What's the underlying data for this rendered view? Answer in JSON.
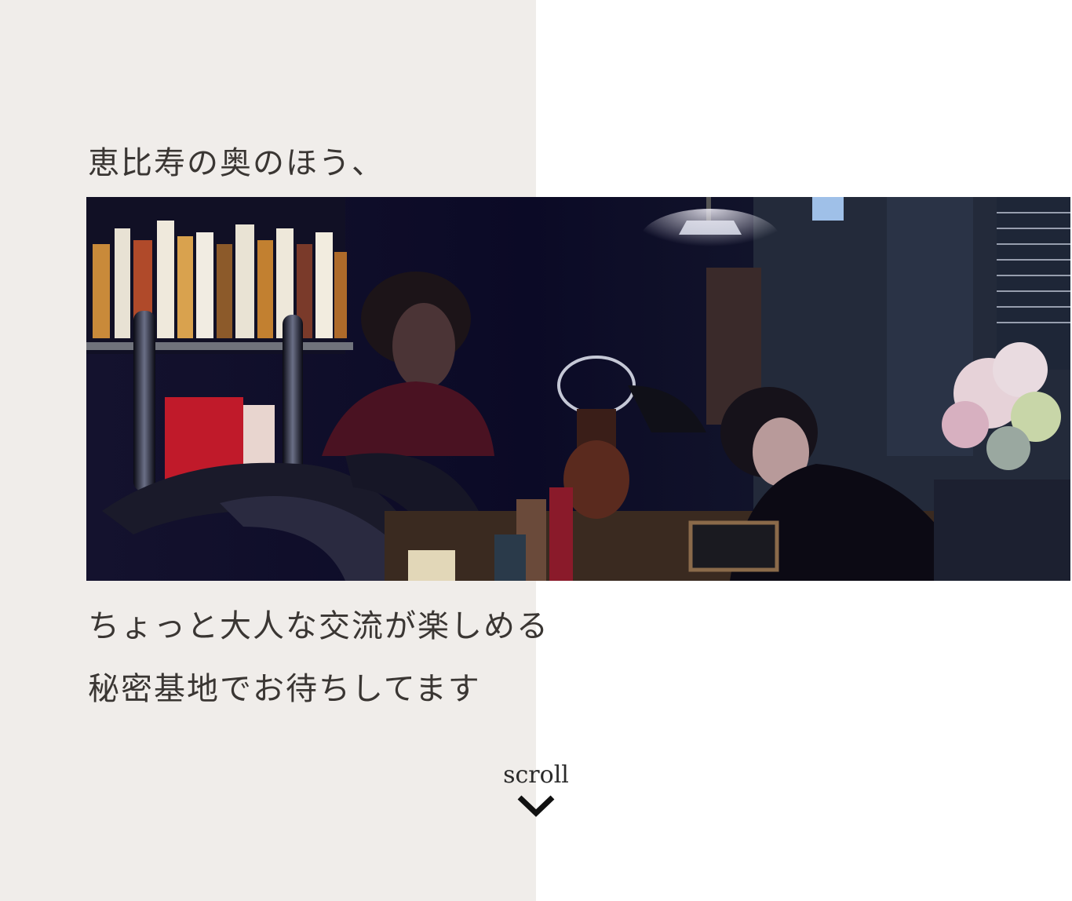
{
  "hero": {
    "line_top": "恵比寿の奥のほう、",
    "line_bottom_1": "ちょっと大人な交流が楽しめる",
    "line_bottom_2": "秘密基地でお待ちしてます"
  },
  "photo": {
    "alt": "バーカウンターの写真",
    "description_icon": "bar-photo"
  },
  "scroll": {
    "label": "scroll",
    "icon": "chevron-down-icon"
  },
  "colors": {
    "left_panel": "#f0edea",
    "background": "#ffffff",
    "text": "#3a3633"
  }
}
